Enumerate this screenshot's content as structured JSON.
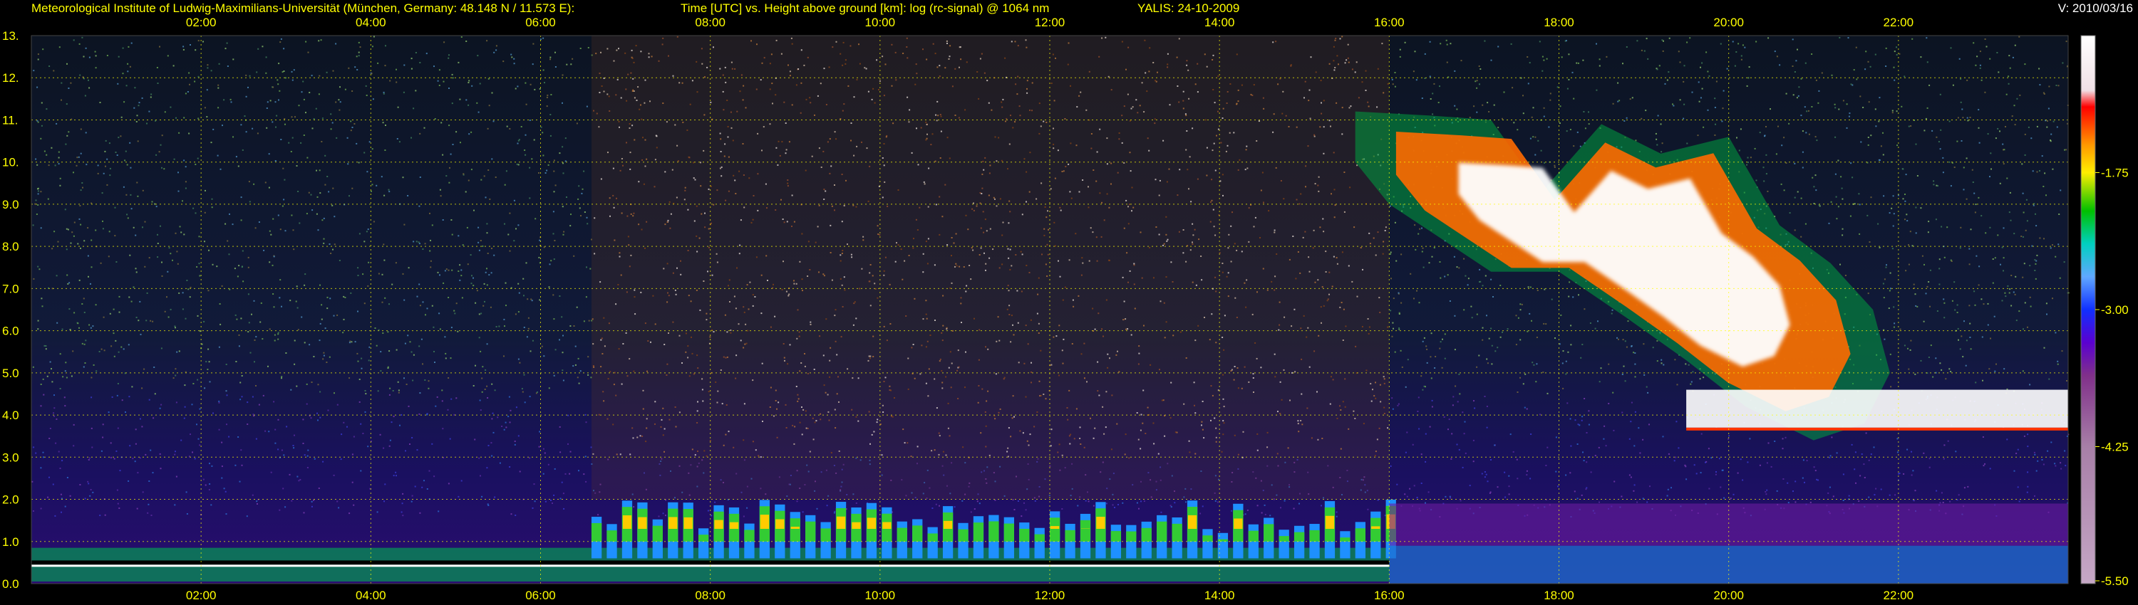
{
  "header": {
    "institute": "Meteorological Institute of Ludwig-Maximilians-Universität (München, Germany: 48.148 N / 11.573 E):",
    "title": "Time [UTC] vs. Height above ground [km]: log (rc-signal) @ 1064 nm",
    "instrument_date": "YALIS: 24-10-2009",
    "version": "V: 2010/03/16"
  },
  "chart_data": {
    "type": "heatmap",
    "title": "Time [UTC] vs. Height above ground [km]: log (rc-signal) @ 1064 nm",
    "x": {
      "unit": "UTC",
      "range_hours": [
        0.0,
        24.0
      ],
      "ticks": [
        "02:00",
        "04:00",
        "06:00",
        "08:00",
        "10:00",
        "12:00",
        "14:00",
        "16:00",
        "18:00",
        "20:00",
        "22:00"
      ],
      "tick_hours": [
        2,
        4,
        6,
        8,
        10,
        12,
        14,
        16,
        18,
        20,
        22
      ]
    },
    "y": {
      "unit": "km",
      "range": [
        0.0,
        13.0
      ],
      "ticks": [
        "0.0",
        "1.0",
        "2.0",
        "3.0",
        "4.0",
        "5.0",
        "6.0",
        "7.0",
        "8.0",
        "9.0",
        "10.",
        "11.",
        "12.",
        "13."
      ]
    },
    "colorbar": {
      "range": [
        -5.5,
        -0.5
      ],
      "labels": [
        "-1.75",
        "-3.00",
        "-4.25",
        "-5.50"
      ],
      "label_values": [
        -1.75,
        -3.0,
        -4.25,
        -5.5
      ]
    },
    "grid": true,
    "features": [
      {
        "kind": "boundary_layer_top",
        "t_start": 0.0,
        "t_end": 16.0,
        "height_km": 0.5
      },
      {
        "kind": "aerosol_layer",
        "t_start": 6.6,
        "t_end": 16.0,
        "height_km": [
          0.6,
          1.8
        ]
      },
      {
        "kind": "cirrus",
        "t_start": 15.6,
        "t_end": 22.0,
        "height_km": [
          3.5,
          11.2
        ]
      },
      {
        "kind": "low_cloud",
        "t_start": 19.5,
        "t_end": 24.0,
        "height_km": [
          3.7,
          4.6
        ]
      }
    ]
  },
  "colors": {
    "frame": "#000000",
    "text": "#ffff00",
    "grid": "#ffff00",
    "version_text": "#ffffff"
  }
}
